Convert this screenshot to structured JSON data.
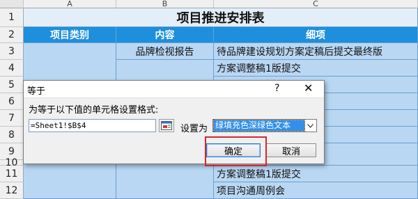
{
  "columns": [
    "A",
    "B",
    "C"
  ],
  "rows": [
    "1",
    "2",
    "3",
    "4",
    "5",
    "6",
    "7",
    "8",
    "9",
    "10",
    "11",
    "12"
  ],
  "sheet": {
    "title": "项目推进安排表",
    "headers": [
      "项目类别",
      "内容",
      "细项"
    ],
    "content_r3": "品牌检视报告",
    "detail_r3": "待品牌建设规划方案定稿后提交最终版",
    "detail_r4": "方案调整稿1版提交",
    "detail_r5_partial": "项目沟通周例会",
    "detail_r11": "方案调整稿1版提交",
    "detail_r12": "项目沟通周例会"
  },
  "dialog": {
    "title": "等于",
    "help": "?",
    "close": "✕",
    "prompt": "为等于以下值的单元格设置格式:",
    "reference_value": "=Sheet1!$B$4",
    "set_as_label": "设置为",
    "format_selected": "绿填充色深绿色文本",
    "ok_label": "确定",
    "cancel_label": "取消"
  },
  "colors": {
    "cell_fill": "#b9d7f3",
    "header_fill": "#1e8fdc",
    "title_fill": "#e4eef9",
    "highlight": "#d9252d"
  },
  "icons": {
    "ref_button": "collapse-dialog-icon",
    "dropdown": "chevron-down-icon"
  }
}
